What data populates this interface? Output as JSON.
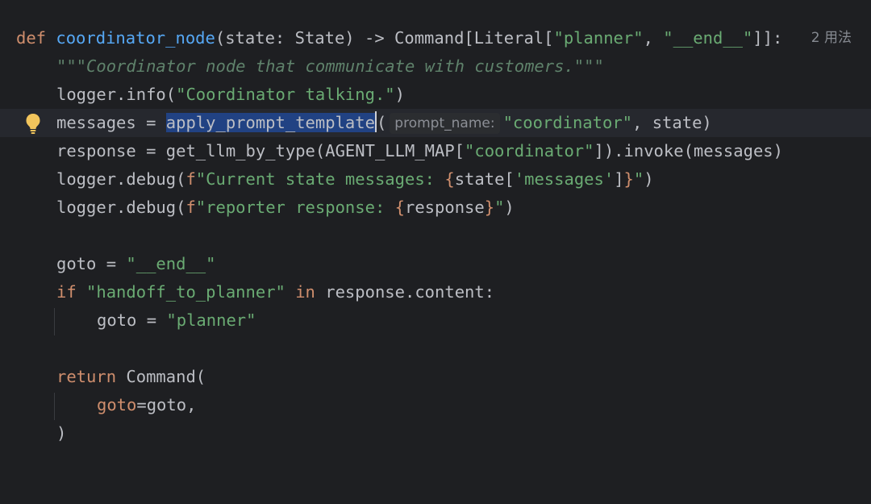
{
  "editor": {
    "usages_hint": "2 用法",
    "param_hint": "prompt_name:",
    "lines": {
      "l1": {
        "kw_def": "def",
        "fn_name": "coordinator_node",
        "sig_a": "(state: State) -> Command[Literal[",
        "s_planner": "\"planner\"",
        "sig_b": ", ",
        "s_end": "\"__end__\"",
        "sig_c": "]]:"
      },
      "l2": {
        "doc": "\"\"\"Coordinator node that communicate with customers.\"\"\""
      },
      "l3": {
        "a": "logger.info(",
        "s": "\"Coordinator talking.\"",
        "b": ")"
      },
      "l4": {
        "a": "messages = ",
        "sel": "apply_prompt_template",
        "b": "(",
        "s": "\"coordinator\"",
        "c": ", state)"
      },
      "l5": {
        "a": "response = get_llm_by_type(AGENT_LLM_MAP[",
        "s": "\"coordinator\"",
        "b": "]).invoke(messages)"
      },
      "l6": {
        "a": "logger.debug(",
        "f": "f",
        "s1": "\"Current state messages: ",
        "br1": "{",
        "expr_a": "state[",
        "s2": "'messages'",
        "expr_b": "]",
        "br2": "}",
        "s3": "\"",
        "b": ")"
      },
      "l7": {
        "a": "logger.debug(",
        "f": "f",
        "s1": "\"reporter response: ",
        "br1": "{",
        "expr": "response",
        "br2": "}",
        "s3": "\"",
        "b": ")"
      },
      "l9": {
        "a": "goto = ",
        "s": "\"__end__\""
      },
      "l10": {
        "kw_if": "if",
        "s": "\"handoff_to_planner\"",
        "kw_in": "in",
        "b": "response.content:"
      },
      "l11": {
        "a": "goto = ",
        "s": "\"planner\""
      },
      "l13": {
        "kw": "return",
        "b": "Command("
      },
      "l14": {
        "kwarg": "goto",
        "b": "=goto,"
      },
      "l15": {
        "b": ")"
      }
    },
    "colors": {
      "background": "#1e1f22",
      "keyword": "#cf8e6d",
      "function": "#56a8f5",
      "string": "#6aab73",
      "docstring": "#5f826b",
      "selection": "#214283"
    },
    "icons": {
      "intention_bulb": "lightbulb-icon"
    }
  }
}
